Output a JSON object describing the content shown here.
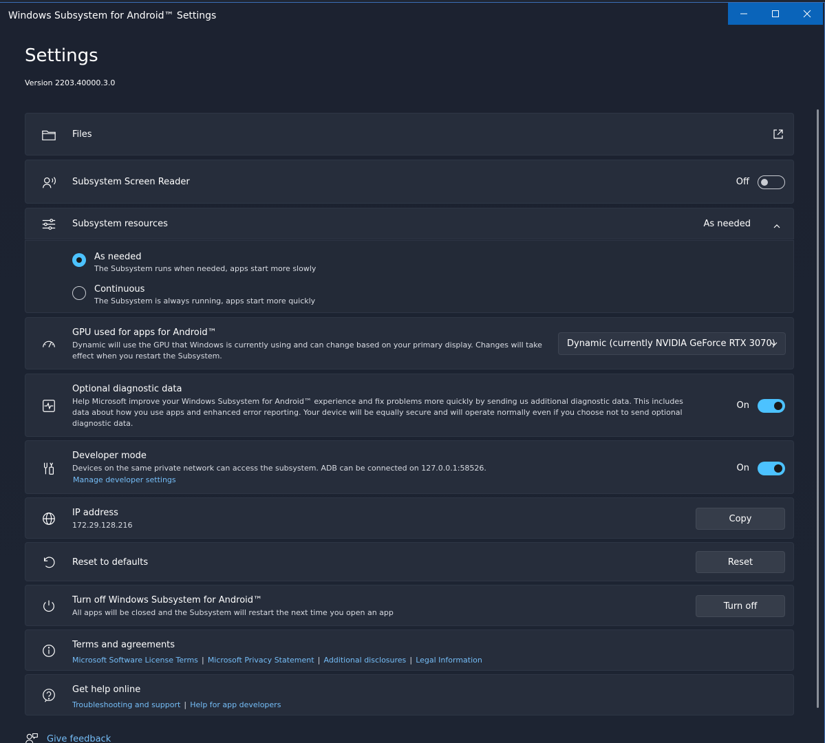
{
  "window": {
    "title": "Windows Subsystem for Android™ Settings"
  },
  "header": {
    "title": "Settings",
    "version": "Version 2203.40000.3.0"
  },
  "files": {
    "label": "Files",
    "icon": "folder-icon",
    "action_icon": "open-external-icon"
  },
  "screen_reader": {
    "label": "Subsystem Screen Reader",
    "state": "Off",
    "icon": "screen-reader-icon"
  },
  "resources": {
    "label": "Subsystem resources",
    "value": "As needed",
    "icon": "sliders-icon",
    "options": [
      {
        "title": "As needed",
        "desc": "The Subsystem runs when needed, apps start more slowly",
        "selected": true
      },
      {
        "title": "Continuous",
        "desc": "The Subsystem is always running, apps start more quickly",
        "selected": false
      }
    ]
  },
  "gpu": {
    "label": "GPU used for apps for Android™",
    "desc": "Dynamic will use the GPU that Windows is currently using and can change based on your primary display. Changes will take effect when you restart the Subsystem.",
    "selected": "Dynamic (currently NVIDIA GeForce RTX 3070)",
    "icon": "gauge-icon"
  },
  "diagnostic": {
    "label": "Optional diagnostic data",
    "desc": "Help Microsoft improve your Windows Subsystem for Android™ experience and fix problems more quickly by sending us additional diagnostic data. This includes data about how you use apps and enhanced error reporting. Your device will be equally secure and will operate normally even if you choose not to send optional diagnostic data.",
    "state": "On",
    "icon": "pulse-icon"
  },
  "developer": {
    "label": "Developer mode",
    "desc": "Devices on the same private network can access the subsystem. ADB can be connected on 127.0.0.1:58526.",
    "link": "Manage developer settings",
    "state": "On",
    "icon": "tools-icon"
  },
  "ip": {
    "label": "IP address",
    "value": "172.29.128.216",
    "button": "Copy",
    "icon": "globe-icon"
  },
  "reset": {
    "label": "Reset to defaults",
    "button": "Reset",
    "icon": "undo-icon"
  },
  "turnoff": {
    "label": "Turn off Windows Subsystem for Android™",
    "desc": "All apps will be closed and the Subsystem will restart the next time you open an app",
    "button": "Turn off",
    "icon": "power-icon"
  },
  "terms": {
    "label": "Terms and agreements",
    "links": [
      "Microsoft Software License Terms",
      "Microsoft Privacy Statement",
      "Additional disclosures",
      "Legal Information"
    ],
    "separator": "|",
    "icon": "info-icon"
  },
  "help": {
    "label": "Get help online",
    "links": [
      "Troubleshooting and support",
      "Help for app developers"
    ],
    "separator": "|",
    "icon": "help-icon"
  },
  "feedback": {
    "label": "Give feedback",
    "icon": "feedback-icon"
  },
  "colors": {
    "accent": "#4cc2ff",
    "link": "#75bdf7",
    "titlebar_buttons": "#0a64ba"
  }
}
